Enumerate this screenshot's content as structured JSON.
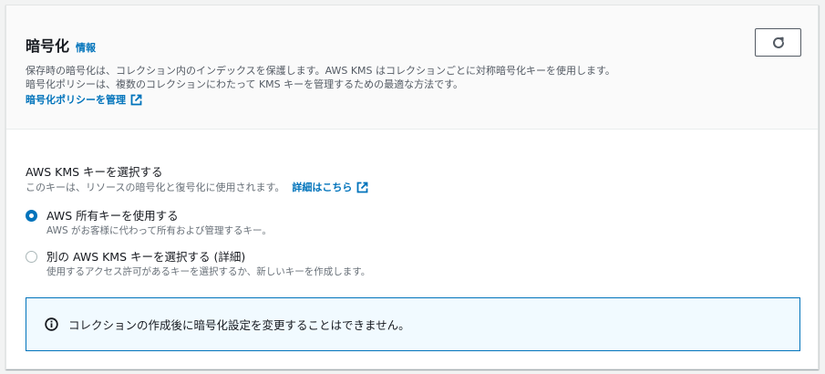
{
  "header": {
    "title": "暗号化",
    "info_link": "情報",
    "description_line1": "保存時の暗号化は、コレクション内のインデックスを保護します。AWS KMS はコレクションごとに対称暗号化キーを使用します。",
    "description_line2": "暗号化ポリシーは、複数のコレクションにわたって KMS キーを管理するための最適な方法です。",
    "manage_policy_link": "暗号化ポリシーを管理",
    "refresh_icon": "refresh-icon"
  },
  "kms": {
    "label": "AWS KMS キーを選択する",
    "description": "このキーは、リソースの暗号化と復号化に使用されます。",
    "detail_link": "詳細はこちら",
    "options": [
      {
        "label": "AWS 所有キーを使用する",
        "sub": "AWS がお客様に代わって所有および管理するキー。",
        "selected": true
      },
      {
        "label": "別の AWS KMS キーを選択する (詳細)",
        "sub": "使用するアクセス許可があるキーを選択するか、新しいキーを作成します。",
        "selected": false
      }
    ]
  },
  "alert": {
    "icon": "info-icon",
    "text": "コレクションの作成後に暗号化設定を変更することはできません。"
  },
  "colors": {
    "accent": "#0073bb",
    "text": "#16191f",
    "muted": "#687078",
    "alert_bg": "#f1faff"
  }
}
